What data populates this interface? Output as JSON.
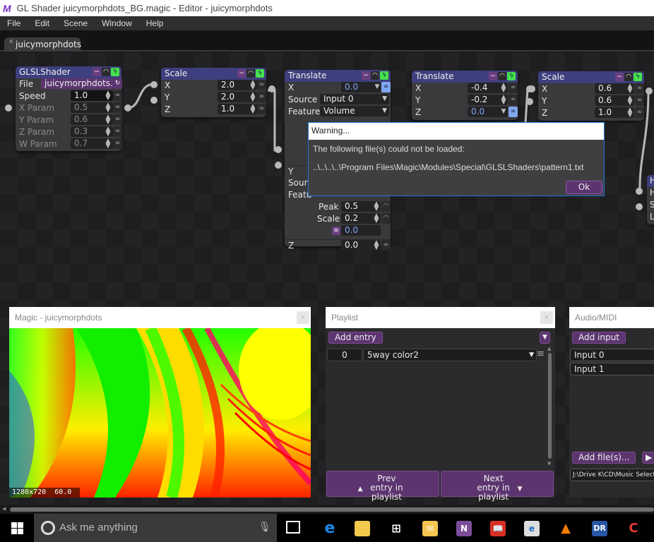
{
  "window": {
    "title": "GL Shader juicymorphdots_BG.magic - Editor - juicymorphdots",
    "logo": "M"
  },
  "menu": [
    "File",
    "Edit",
    "Scene",
    "Window",
    "Help"
  ],
  "tabs": [
    {
      "label": "juicymorphdots",
      "close": "x"
    }
  ],
  "nodes": {
    "glsl": {
      "title": "GLSLShader",
      "file_label": "File",
      "file_value": "juicymorphdots....",
      "params": [
        {
          "label": "Speed",
          "value": "1.0"
        },
        {
          "label": "X Param",
          "value": "0.5"
        },
        {
          "label": "Y Param",
          "value": "0.6"
        },
        {
          "label": "Z Param",
          "value": "0.3"
        },
        {
          "label": "W Param",
          "value": "0.7"
        }
      ]
    },
    "scale1": {
      "title": "Scale",
      "params": [
        {
          "label": "X",
          "value": "2.0"
        },
        {
          "label": "Y",
          "value": "2.0"
        },
        {
          "label": "Z",
          "value": "1.0"
        }
      ]
    },
    "translate1": {
      "title": "Translate",
      "x_label": "X",
      "x_value": "0.0",
      "source_label": "Source",
      "source_value": "Input 0",
      "feature_label": "Feature",
      "feature_value": "Volume",
      "y_label": "Y",
      "source2": "Sourc",
      "feature2": "Featu",
      "peak_label": "Peak",
      "peak_value": "0.5",
      "scale_label": "Scale",
      "scale_value": "0.2",
      "offset_value": "0.0",
      "z_label": "Z",
      "z_value": "0.0"
    },
    "translate2": {
      "title": "Translate",
      "params": [
        {
          "label": "X",
          "value": "-0.4"
        },
        {
          "label": "Y",
          "value": "-0.2"
        },
        {
          "label": "Z",
          "value": "0.0"
        }
      ]
    },
    "scale2": {
      "title": "Scale",
      "params": [
        {
          "label": "X",
          "value": "0.6"
        },
        {
          "label": "Y",
          "value": "0.6"
        },
        {
          "label": "Z",
          "value": "1.0"
        }
      ]
    },
    "hsl": {
      "title": "H",
      "rows": [
        "H",
        "S",
        "L"
      ]
    }
  },
  "dialog": {
    "title": "Warning...",
    "message": "The following file(s) could not be loaded:",
    "path": "..\\..\\..\\..\\Program Files\\Magic\\Modules\\Special\\GLSLShaders\\pattern1.txt",
    "ok": "Ok"
  },
  "preview": {
    "title": "Magic - juicymorphdots",
    "close": "x",
    "resolution": "1280x720",
    "fps": "60.0"
  },
  "playlist": {
    "title": "Playlist",
    "close": "x",
    "add_entry": "Add entry",
    "entries": [
      {
        "index": "0",
        "name": "5way color2"
      }
    ],
    "prev": "Prev entry in playlist",
    "next": "Next entry in playlist"
  },
  "audio": {
    "title": "Audio/MIDI",
    "add_input": "Add input",
    "inputs": [
      "Input 0",
      "Input 1"
    ],
    "add_files": "Add file(s)...",
    "path": "J:\\Drive K\\CD\\Music Selection"
  },
  "taskbar": {
    "search_placeholder": "Ask me anything",
    "apps": [
      "edge",
      "file-explorer",
      "store",
      "outlook",
      "onenote",
      "reader",
      "app-e",
      "vlc",
      "dynamic-range",
      "ccleaner"
    ]
  }
}
